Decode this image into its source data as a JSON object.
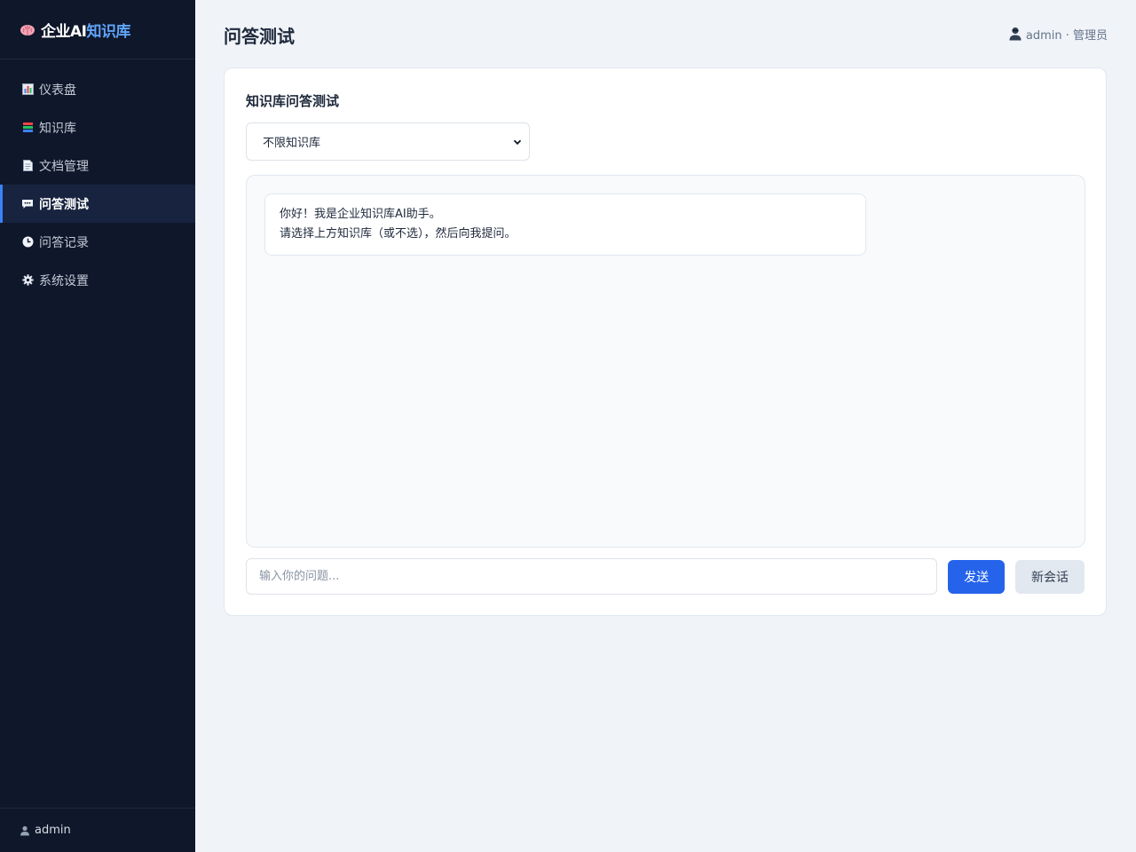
{
  "brand": {
    "prefix": "企业AI",
    "accent": "知识库",
    "icon": "brain-icon"
  },
  "sidebar": {
    "items": [
      {
        "label": "仪表盘",
        "icon": "bar-chart-icon",
        "active": false
      },
      {
        "label": "知识库",
        "icon": "books-icon",
        "active": false
      },
      {
        "label": "文档管理",
        "icon": "document-icon",
        "active": false
      },
      {
        "label": "问答测试",
        "icon": "chat-bubble-icon",
        "active": true
      },
      {
        "label": "问答记录",
        "icon": "clock-icon",
        "active": false
      },
      {
        "label": "系统设置",
        "icon": "gear-icon",
        "active": false
      }
    ],
    "footer_user": "admin"
  },
  "header": {
    "title": "问答测试",
    "user": "admin · 管理员"
  },
  "card": {
    "title": "知识库问答测试",
    "select_value": "不限知识库",
    "welcome_line1": "你好！我是企业知识库AI助手。",
    "welcome_line2": "请选择上方知识库（或不选），然后向我提问。",
    "input_placeholder": "输入你的问题...",
    "send_label": "发送",
    "new_session_label": "新会话"
  },
  "colors": {
    "sidebar_bg": "#0f172a",
    "accent": "#60a5fa",
    "primary_button": "#2563eb",
    "page_bg": "#f0f3f8"
  }
}
